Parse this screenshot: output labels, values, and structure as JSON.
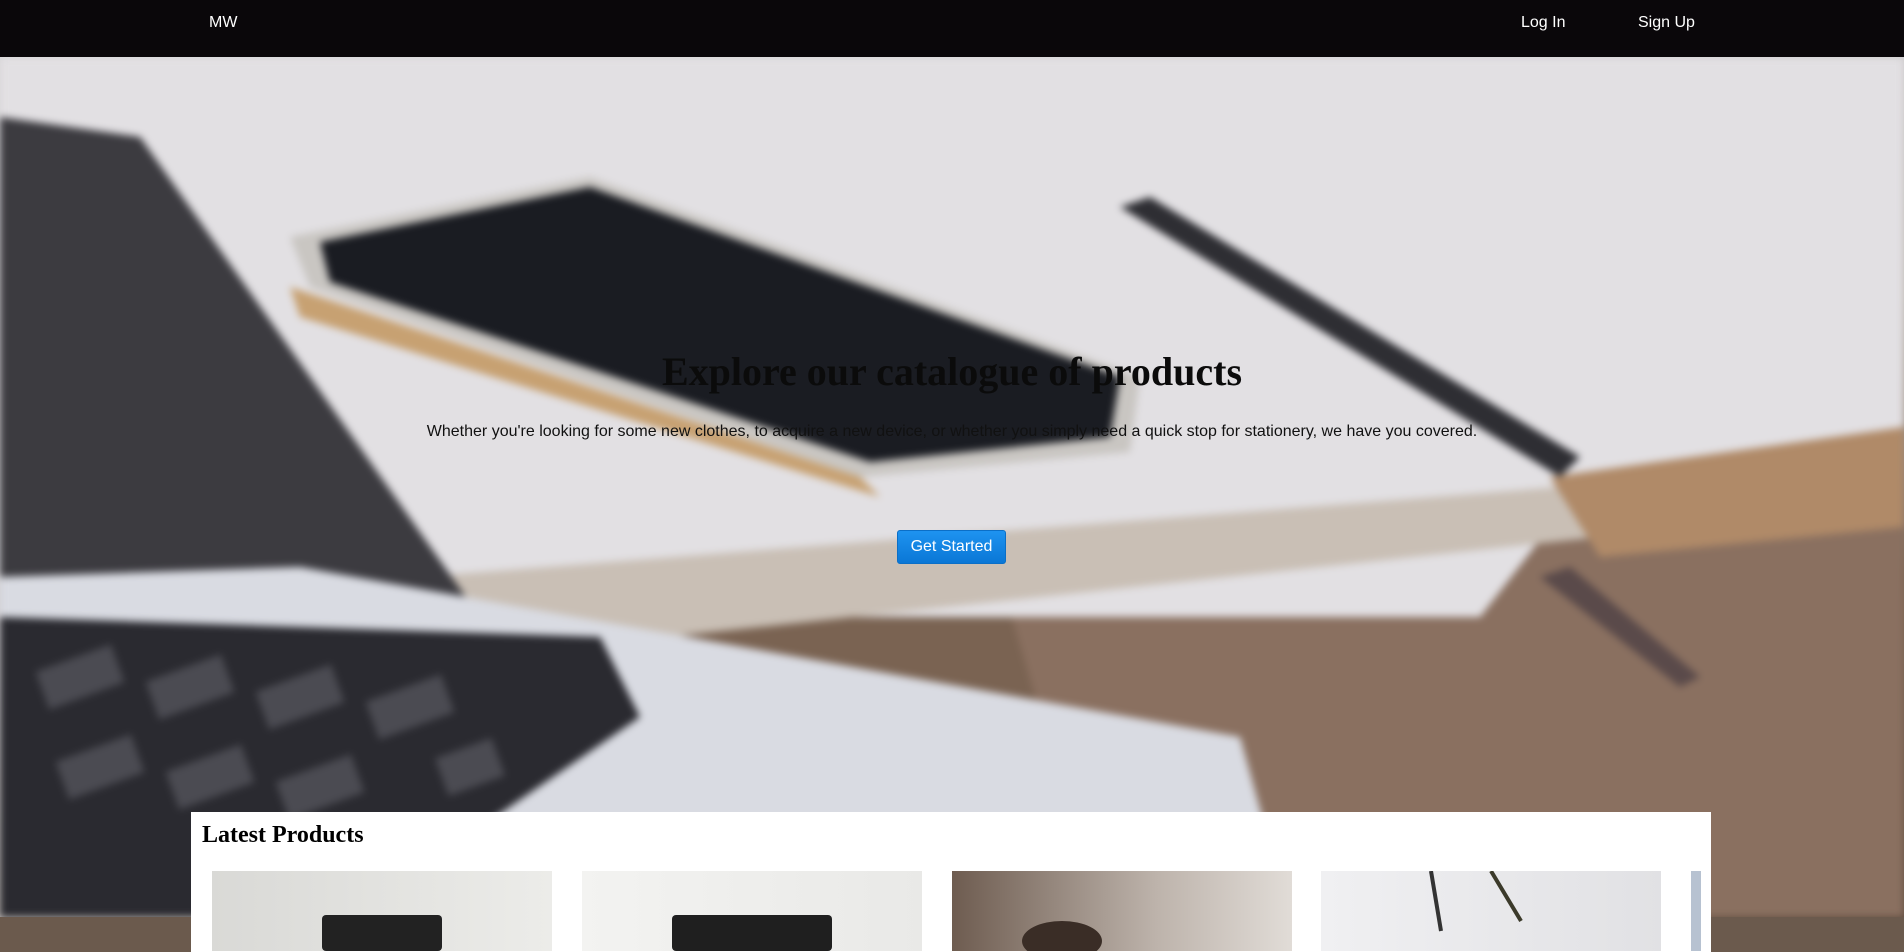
{
  "nav": {
    "brand": "MW",
    "login": "Log In",
    "signup": "Sign Up"
  },
  "hero": {
    "title": "Explore our catalogue of products",
    "subtitle": "Whether you're looking for some new clothes, to acquire a new device, or whether you simply need a quick stop for stationery, we have you covered.",
    "cta": "Get Started"
  },
  "latest": {
    "title": "Latest Products"
  },
  "colors": {
    "navbar_bg": "#0a070a",
    "cta_bg": "#1e88e5"
  }
}
